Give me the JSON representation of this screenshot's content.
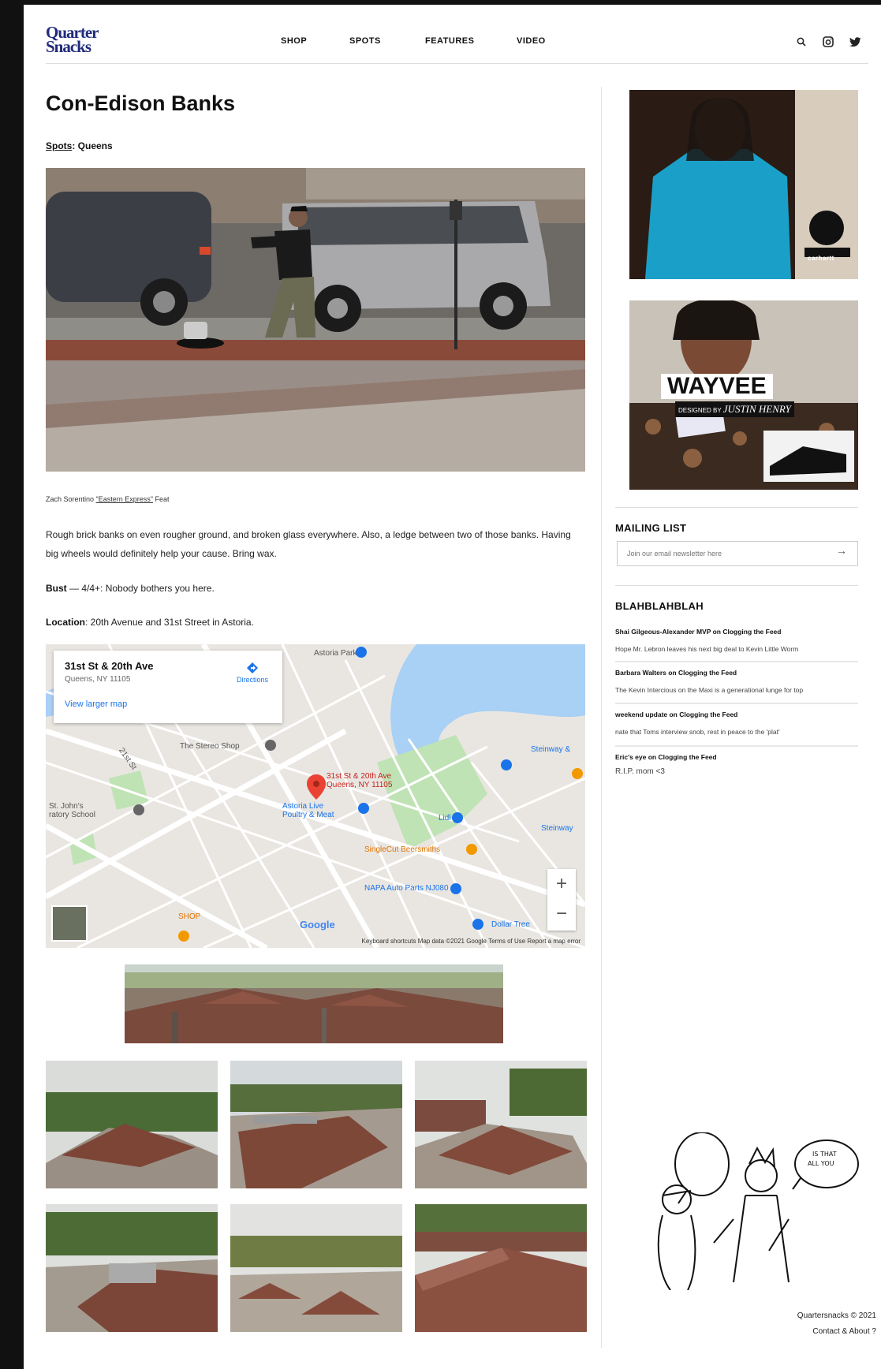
{
  "header": {
    "logo_line1": "Quarter",
    "logo_line2": "Snacks",
    "nav": [
      "SHOP",
      "SPOTS",
      "FEATURES",
      "VIDEO"
    ]
  },
  "article": {
    "title": "Con-Edison Banks",
    "breadcrumb_label": "Spots",
    "breadcrumb_value": ": Queens",
    "caption_prefix": "Zach Sorentino ",
    "caption_link": "\"Eastern Express\"",
    "caption_suffix": " Feat",
    "description": "Rough brick banks on even rougher ground, and broken glass everywhere. Also, a ledge between two of those banks. Having big wheels would definitely help your cause. Bring wax.",
    "bust_label": "Bust",
    "bust_text": " — 4/4+: Nobody bothers you here.",
    "location_label": "Location",
    "location_text": ": 20th Avenue and 31st Street in Astoria."
  },
  "map": {
    "place_name": "31st St & 20th Ave",
    "place_address": "Queens, NY 11105",
    "view_larger": "View larger map",
    "directions": "Directions",
    "pin_label": "31st St & 20th Ave\nQueens, NY 11105",
    "labels": [
      "Astoria Park",
      "The Stereo Shop",
      "Astoria Live\nPoultry & Meat",
      "Lidl",
      "SingleCut Beersmiths",
      "NAPA Auto Parts NJ080",
      "Steinway &",
      "St. John's\nratory School",
      "Dollar Tree",
      "Steinway",
      "21st St",
      "SHOP"
    ],
    "zoom_in": "+",
    "zoom_out": "−",
    "google": "Google",
    "terms": "Keyboard shortcuts   Map data ©2021 Google   Terms of Use   Report a map error"
  },
  "sidebar": {
    "mailing_title": "MAILING LIST",
    "mailing_placeholder": "Join our email newsletter here",
    "blah_title": "BLAHBLAHBLAH",
    "comments": [
      {
        "title": "Shai Gilgeous-Alexander MVP on Clogging the Feed",
        "snippet": "Hope Mr. Lebron leaves his next big deal to Kevin Little Worm"
      },
      {
        "title": "Barbara Walters on Clogging the Feed",
        "snippet": "The Kevin Intercious on the Maxi is a generational lunge for top"
      },
      {
        "title": "weekend update on Clogging the Feed",
        "snippet": "nate that Toms interview snob, rest in peace to the 'plat'"
      },
      {
        "title": "Eric's eye on Clogging the Feed",
        "snippet": "R.I.P. mom <3"
      }
    ],
    "footer_line1": "Quartersnacks © 2021",
    "footer_line2": "Contact & About ?"
  },
  "ad2": {
    "headline": "WAYVEE",
    "sub_prefix": "DESIGNED BY",
    "sub_name": "JUSTIN HENRY"
  },
  "ad1": {
    "brand": "carhartt"
  }
}
